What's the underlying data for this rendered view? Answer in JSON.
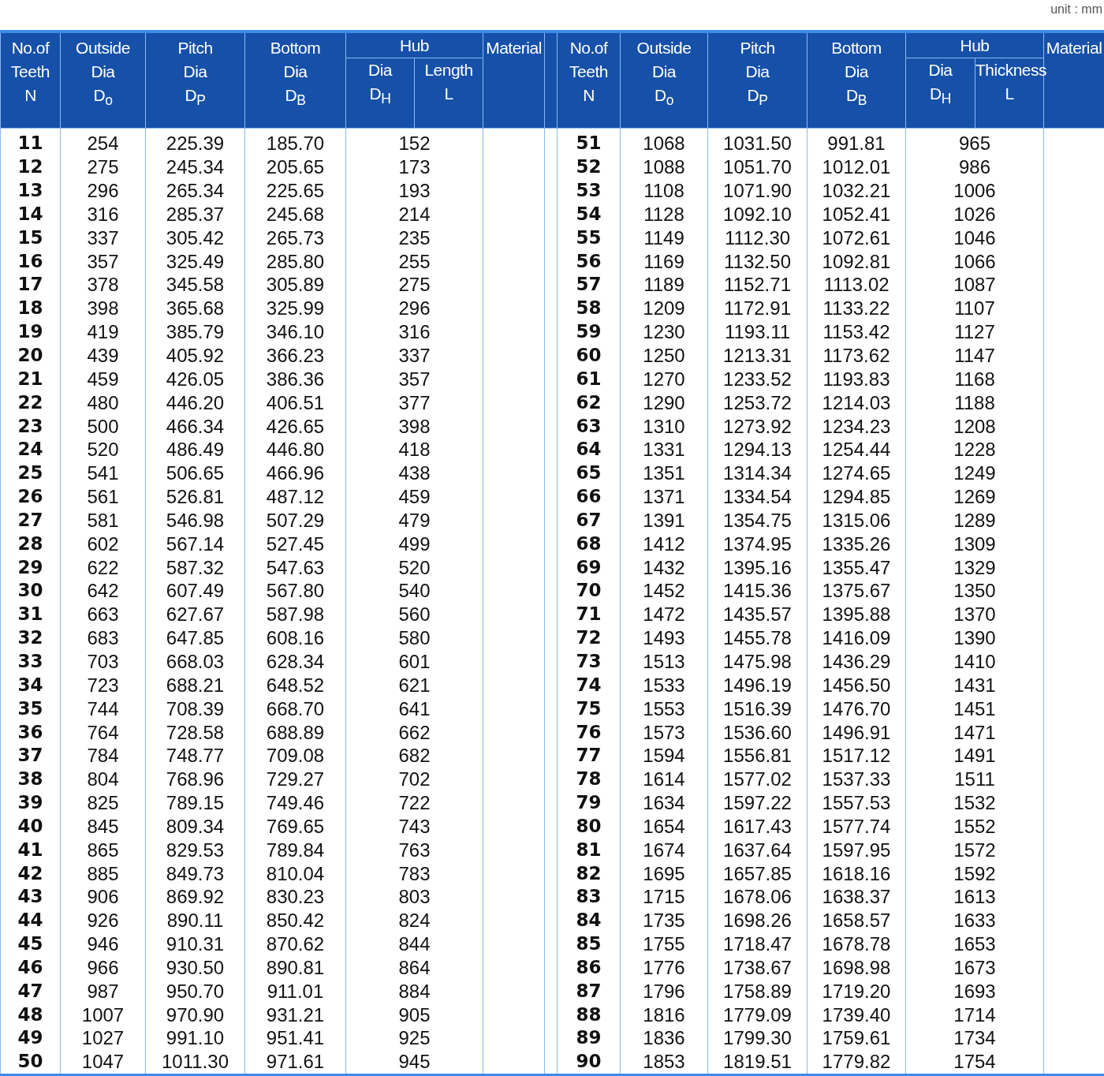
{
  "unit": "unit : mm",
  "tables": [
    {
      "headers": [
        {
          "lines": [
            "No.of",
            "Teeth",
            "N"
          ]
        },
        {
          "lines": [
            "Outside",
            "Dia",
            "D$_{o}$"
          ]
        },
        {
          "lines": [
            "Pitch",
            "Dia",
            "D$_{P}$"
          ]
        },
        {
          "lines": [
            "Bottom",
            "Dia",
            "D$_{B}$"
          ]
        },
        {
          "label": "Hub",
          "children": [
            {
              "lines": [
                "Dia",
                "D$_{H}$"
              ]
            },
            {
              "lines": [
                "Length",
                "L"
              ]
            }
          ]
        },
        {
          "lines": [
            "Material"
          ]
        }
      ],
      "rows": [
        [
          "11",
          "254",
          "225.39",
          "185.70",
          "152"
        ],
        [
          "12",
          "275",
          "245.34",
          "205.65",
          "173"
        ],
        [
          "13",
          "296",
          "265.34",
          "225.65",
          "193"
        ],
        [
          "14",
          "316",
          "285.37",
          "245.68",
          "214"
        ],
        [
          "15",
          "337",
          "305.42",
          "265.73",
          "235"
        ],
        [
          "16",
          "357",
          "325.49",
          "285.80",
          "255"
        ],
        [
          "17",
          "378",
          "345.58",
          "305.89",
          "275"
        ],
        [
          "18",
          "398",
          "365.68",
          "325.99",
          "296"
        ],
        [
          "19",
          "419",
          "385.79",
          "346.10",
          "316"
        ],
        [
          "20",
          "439",
          "405.92",
          "366.23",
          "337"
        ],
        [
          "21",
          "459",
          "426.05",
          "386.36",
          "357"
        ],
        [
          "22",
          "480",
          "446.20",
          "406.51",
          "377"
        ],
        [
          "23",
          "500",
          "466.34",
          "426.65",
          "398"
        ],
        [
          "24",
          "520",
          "486.49",
          "446.80",
          "418"
        ],
        [
          "25",
          "541",
          "506.65",
          "466.96",
          "438"
        ],
        [
          "26",
          "561",
          "526.81",
          "487.12",
          "459"
        ],
        [
          "27",
          "581",
          "546.98",
          "507.29",
          "479"
        ],
        [
          "28",
          "602",
          "567.14",
          "527.45",
          "499"
        ],
        [
          "29",
          "622",
          "587.32",
          "547.63",
          "520"
        ],
        [
          "30",
          "642",
          "607.49",
          "567.80",
          "540"
        ],
        [
          "31",
          "663",
          "627.67",
          "587.98",
          "560"
        ],
        [
          "32",
          "683",
          "647.85",
          "608.16",
          "580"
        ],
        [
          "33",
          "703",
          "668.03",
          "628.34",
          "601"
        ],
        [
          "34",
          "723",
          "688.21",
          "648.52",
          "621"
        ],
        [
          "35",
          "744",
          "708.39",
          "668.70",
          "641"
        ],
        [
          "36",
          "764",
          "728.58",
          "688.89",
          "662"
        ],
        [
          "37",
          "784",
          "748.77",
          "709.08",
          "682"
        ],
        [
          "38",
          "804",
          "768.96",
          "729.27",
          "702"
        ],
        [
          "39",
          "825",
          "789.15",
          "749.46",
          "722"
        ],
        [
          "40",
          "845",
          "809.34",
          "769.65",
          "743"
        ],
        [
          "41",
          "865",
          "829.53",
          "789.84",
          "763"
        ],
        [
          "42",
          "885",
          "849.73",
          "810.04",
          "783"
        ],
        [
          "43",
          "906",
          "869.92",
          "830.23",
          "803"
        ],
        [
          "44",
          "926",
          "890.11",
          "850.42",
          "824"
        ],
        [
          "45",
          "946",
          "910.31",
          "870.62",
          "844"
        ],
        [
          "46",
          "966",
          "930.50",
          "890.81",
          "864"
        ],
        [
          "47",
          "987",
          "950.70",
          "911.01",
          "884"
        ],
        [
          "48",
          "1007",
          "970.90",
          "931.21",
          "905"
        ],
        [
          "49",
          "1027",
          "991.10",
          "951.41",
          "925"
        ],
        [
          "50",
          "1047",
          "1011.30",
          "971.61",
          "945"
        ]
      ]
    },
    {
      "headers": [
        {
          "lines": [
            "No.of",
            "Teeth",
            "N"
          ]
        },
        {
          "lines": [
            "Outside",
            "Dia",
            "D$_{o}$"
          ]
        },
        {
          "lines": [
            "Pitch",
            "Dia",
            "D$_{P}$"
          ]
        },
        {
          "lines": [
            "Bottom",
            "Dia",
            "D$_{B}$"
          ]
        },
        {
          "label": "Hub",
          "children": [
            {
              "lines": [
                "Dia",
                "D$_{H}$"
              ]
            },
            {
              "lines": [
                "Thickness",
                "L"
              ]
            }
          ]
        },
        {
          "lines": [
            "Material"
          ]
        }
      ],
      "rows": [
        [
          "51",
          "1068",
          "1031.50",
          "991.81",
          "965"
        ],
        [
          "52",
          "1088",
          "1051.70",
          "1012.01",
          "986"
        ],
        [
          "53",
          "1108",
          "1071.90",
          "1032.21",
          "1006"
        ],
        [
          "54",
          "1128",
          "1092.10",
          "1052.41",
          "1026"
        ],
        [
          "55",
          "1149",
          "1112.30",
          "1072.61",
          "1046"
        ],
        [
          "56",
          "1169",
          "1132.50",
          "1092.81",
          "1066"
        ],
        [
          "57",
          "1189",
          "1152.71",
          "1113.02",
          "1087"
        ],
        [
          "58",
          "1209",
          "1172.91",
          "1133.22",
          "1107"
        ],
        [
          "59",
          "1230",
          "1193.11",
          "1153.42",
          "1127"
        ],
        [
          "60",
          "1250",
          "1213.31",
          "1173.62",
          "1147"
        ],
        [
          "61",
          "1270",
          "1233.52",
          "1193.83",
          "1168"
        ],
        [
          "62",
          "1290",
          "1253.72",
          "1214.03",
          "1188"
        ],
        [
          "63",
          "1310",
          "1273.92",
          "1234.23",
          "1208"
        ],
        [
          "64",
          "1331",
          "1294.13",
          "1254.44",
          "1228"
        ],
        [
          "65",
          "1351",
          "1314.34",
          "1274.65",
          "1249"
        ],
        [
          "66",
          "1371",
          "1334.54",
          "1294.85",
          "1269"
        ],
        [
          "67",
          "1391",
          "1354.75",
          "1315.06",
          "1289"
        ],
        [
          "68",
          "1412",
          "1374.95",
          "1335.26",
          "1309"
        ],
        [
          "69",
          "1432",
          "1395.16",
          "1355.47",
          "1329"
        ],
        [
          "70",
          "1452",
          "1415.36",
          "1375.67",
          "1350"
        ],
        [
          "71",
          "1472",
          "1435.57",
          "1395.88",
          "1370"
        ],
        [
          "72",
          "1493",
          "1455.78",
          "1416.09",
          "1390"
        ],
        [
          "73",
          "1513",
          "1475.98",
          "1436.29",
          "1410"
        ],
        [
          "74",
          "1533",
          "1496.19",
          "1456.50",
          "1431"
        ],
        [
          "75",
          "1553",
          "1516.39",
          "1476.70",
          "1451"
        ],
        [
          "76",
          "1573",
          "1536.60",
          "1496.91",
          "1471"
        ],
        [
          "77",
          "1594",
          "1556.81",
          "1517.12",
          "1491"
        ],
        [
          "78",
          "1614",
          "1577.02",
          "1537.33",
          "1511"
        ],
        [
          "79",
          "1634",
          "1597.22",
          "1557.53",
          "1532"
        ],
        [
          "80",
          "1654",
          "1617.43",
          "1577.74",
          "1552"
        ],
        [
          "81",
          "1674",
          "1637.64",
          "1597.95",
          "1572"
        ],
        [
          "82",
          "1695",
          "1657.85",
          "1618.16",
          "1592"
        ],
        [
          "83",
          "1715",
          "1678.06",
          "1638.37",
          "1613"
        ],
        [
          "84",
          "1735",
          "1698.26",
          "1658.57",
          "1633"
        ],
        [
          "85",
          "1755",
          "1718.47",
          "1678.78",
          "1653"
        ],
        [
          "86",
          "1776",
          "1738.67",
          "1698.98",
          "1673"
        ],
        [
          "87",
          "1796",
          "1758.89",
          "1719.20",
          "1693"
        ],
        [
          "88",
          "1816",
          "1779.09",
          "1739.40",
          "1714"
        ],
        [
          "89",
          "1836",
          "1799.30",
          "1759.61",
          "1734"
        ],
        [
          "90",
          "1853",
          "1819.51",
          "1779.82",
          "1754"
        ]
      ]
    }
  ]
}
